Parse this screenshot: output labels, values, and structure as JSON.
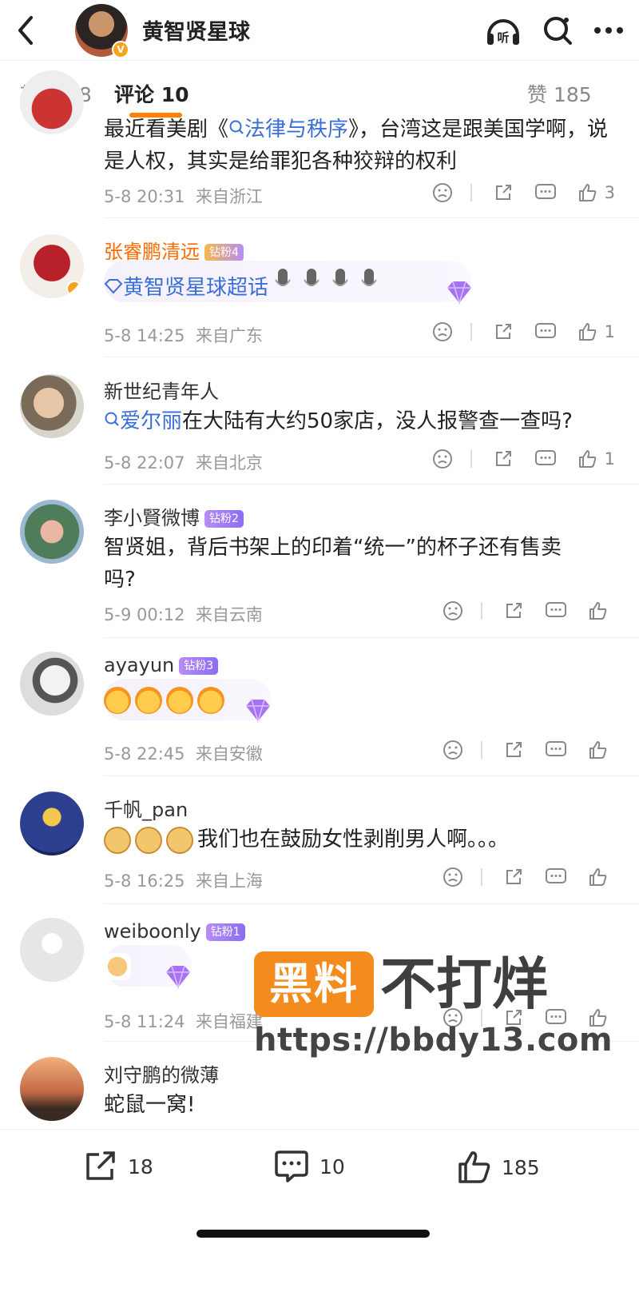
{
  "header": {
    "title": "黄智贤星球"
  },
  "tabs": {
    "repost": "转发 18",
    "comments": "评论 10",
    "likes": "赞 185"
  },
  "comments": [
    {
      "name": "",
      "text_prefix": "最近看美剧《",
      "text_link": "法律与秩序",
      "text_rest": "》，台湾这是跟美国学啊，说是人权，其实是给罪犯各种狡辩的权利",
      "date": "5-8 20:31",
      "location": "来自浙江",
      "likes": "3"
    },
    {
      "name": "张睿鹏清远",
      "badge": "钻粉4",
      "text_link": "黄智贤星球超话",
      "date": "5-8 14:25",
      "location": "来自广东",
      "likes": "1"
    },
    {
      "name": "新世纪青年人",
      "text_link": "爱尔丽",
      "text_rest": "在大陆有大约50家店，没人报警查一查吗?",
      "date": "5-8 22:07",
      "location": "来自北京",
      "likes": "1"
    },
    {
      "name": "李小賢微博",
      "badge": "钻粉2",
      "text": "智贤姐，背后书架上的印着“统一”的杯子还有售卖吗?",
      "date": "5-9 00:12",
      "location": "来自云南",
      "likes": ""
    },
    {
      "name": "ayayun",
      "badge": "钻粉3",
      "date": "5-8 22:45",
      "location": "来自安徽",
      "likes": ""
    },
    {
      "name": "千帆_pan",
      "text": "我们也在鼓励女性剥削男人啊。。。",
      "date": "5-8 16:25",
      "location": "来自上海",
      "likes": ""
    },
    {
      "name": "weiboonly",
      "badge": "钻粉1",
      "date": "5-8 11:24",
      "location": "来自福建",
      "likes": ""
    },
    {
      "name": "刘守鹏的微薄",
      "text": "蛇鼠一窝!"
    }
  ],
  "bottom_bar": {
    "reposts": "18",
    "comments": "10",
    "likes": "185"
  },
  "watermark": {
    "logo": "黑料",
    "big": "不打烊",
    "url": "https://bbdy13.com"
  },
  "colors": {
    "accent": "#ff8200",
    "link": "#3a6fd8",
    "badge": "#9b7af5"
  }
}
